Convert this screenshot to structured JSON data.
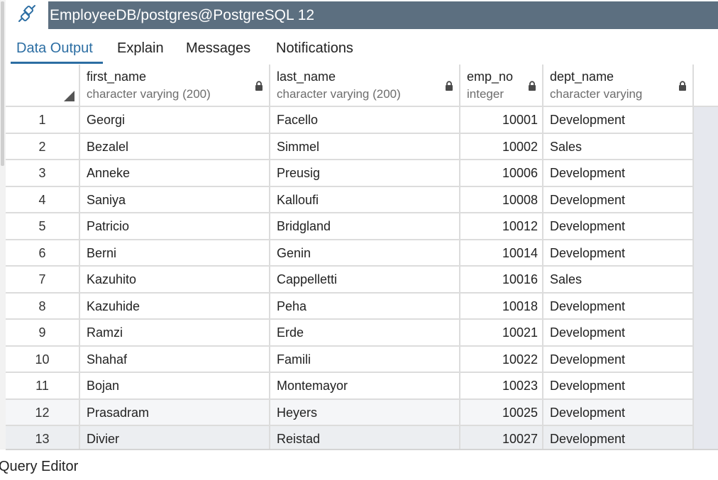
{
  "titlebar": {
    "connection_icon": "plug-connect-icon",
    "title": "EmployeeDB/postgres@PostgreSQL 12"
  },
  "tabs": [
    {
      "label": "Data Output",
      "active": true
    },
    {
      "label": "Explain",
      "active": false
    },
    {
      "label": "Messages",
      "active": false
    },
    {
      "label": "Notifications",
      "active": false
    }
  ],
  "grid": {
    "columns": [
      {
        "name": "first_name",
        "type": "character varying (200)",
        "locked": true
      },
      {
        "name": "last_name",
        "type": "character varying (200)",
        "locked": true
      },
      {
        "name": "emp_no",
        "type": "integer",
        "locked": true
      },
      {
        "name": "dept_name",
        "type": "character varying",
        "locked": true
      }
    ],
    "rows": [
      {
        "n": "1",
        "first_name": "Georgi",
        "last_name": "Facello",
        "emp_no": "10001",
        "dept_name": "Development"
      },
      {
        "n": "2",
        "first_name": "Bezalel",
        "last_name": "Simmel",
        "emp_no": "10002",
        "dept_name": "Sales"
      },
      {
        "n": "3",
        "first_name": "Anneke",
        "last_name": "Preusig",
        "emp_no": "10006",
        "dept_name": "Development"
      },
      {
        "n": "4",
        "first_name": "Saniya",
        "last_name": "Kalloufi",
        "emp_no": "10008",
        "dept_name": "Development"
      },
      {
        "n": "5",
        "first_name": "Patricio",
        "last_name": "Bridgland",
        "emp_no": "10012",
        "dept_name": "Development"
      },
      {
        "n": "6",
        "first_name": "Berni",
        "last_name": "Genin",
        "emp_no": "10014",
        "dept_name": "Development"
      },
      {
        "n": "7",
        "first_name": "Kazuhito",
        "last_name": "Cappelletti",
        "emp_no": "10016",
        "dept_name": "Sales"
      },
      {
        "n": "8",
        "first_name": "Kazuhide",
        "last_name": "Peha",
        "emp_no": "10018",
        "dept_name": "Development"
      },
      {
        "n": "9",
        "first_name": "Ramzi",
        "last_name": "Erde",
        "emp_no": "10021",
        "dept_name": "Development"
      },
      {
        "n": "10",
        "first_name": "Shahaf",
        "last_name": "Famili",
        "emp_no": "10022",
        "dept_name": "Development"
      },
      {
        "n": "11",
        "first_name": "Bojan",
        "last_name": "Montemayor",
        "emp_no": "10023",
        "dept_name": "Development"
      },
      {
        "n": "12",
        "first_name": "Prasadram",
        "last_name": "Heyers",
        "emp_no": "10025",
        "dept_name": "Development"
      },
      {
        "n": "13",
        "first_name": "Divier",
        "last_name": "Reistad",
        "emp_no": "10027",
        "dept_name": "Development"
      }
    ]
  },
  "footer": {
    "query_editor_label": "Query Editor"
  },
  "colors": {
    "titlebar_bg": "#5c6f80",
    "accent": "#2c6ea3",
    "grid_border": "#dcdcdc",
    "filler": "#e6e8ee"
  }
}
